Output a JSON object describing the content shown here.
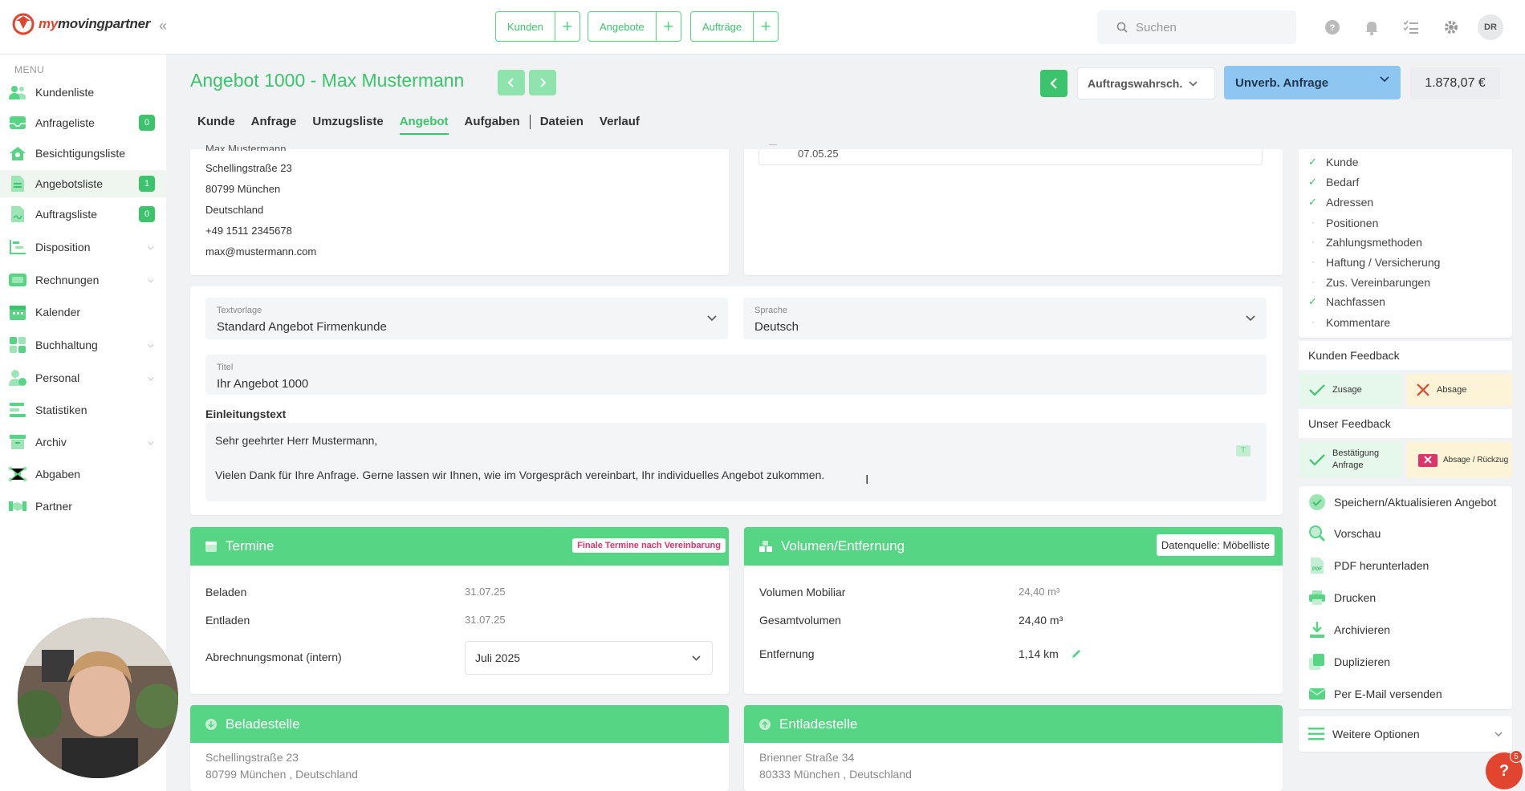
{
  "brand": {
    "logo_prefix": "my",
    "logo_main": "movingpartner"
  },
  "topbar": {
    "quick_buttons": [
      {
        "label": "Kunden"
      },
      {
        "label": "Angebote"
      },
      {
        "label": "Aufträge"
      }
    ],
    "search_placeholder": "Suchen",
    "avatar_initials": "DR",
    "help_badge": "5"
  },
  "sidebar": {
    "menu_label": "MENU",
    "items": [
      {
        "label": "Kundenliste"
      },
      {
        "label": "Anfrageliste",
        "badge": "0"
      },
      {
        "label": "Besichtigungsliste"
      },
      {
        "label": "Angebotsliste",
        "badge": "1",
        "active": true
      },
      {
        "label": "Auftragsliste",
        "badge": "0"
      },
      {
        "label": "Disposition"
      },
      {
        "label": "Rechnungen"
      },
      {
        "label": "Kalender"
      },
      {
        "label": "Buchhaltung"
      },
      {
        "label": "Personal"
      },
      {
        "label": "Statistiken"
      },
      {
        "label": "Archiv"
      },
      {
        "label": "Abgaben"
      },
      {
        "label": "Partner"
      }
    ]
  },
  "header": {
    "title": "Angebot 1000 - Max Mustermann",
    "tabs": [
      "Kunde",
      "Anfrage",
      "Umzugsliste",
      "Angebot",
      "Aufgaben",
      "Dateien",
      "Verlauf"
    ],
    "active_tab": "Angebot",
    "probability_select": "Auftragswahrsch.",
    "status_select": "Unverb. Anfrage",
    "total_price": "1.878,07 €"
  },
  "customer": {
    "name_cut": "Max Mustermann",
    "street": "Schellingstraße 23",
    "city": "80799 München",
    "country": "Deutschland",
    "phone": "+49 1511 2345678",
    "email": "max@mustermann.com",
    "date_value": "07.05.25"
  },
  "offer_form": {
    "template_label": "Textvorlage",
    "template_value": "Standard Angebot Firmenkunde",
    "language_label": "Sprache",
    "language_value": "Deutsch",
    "title_label": "Titel",
    "title_value": "Ihr Angebot 1000",
    "intro_label": "Einleitungstext",
    "intro_line1": "Sehr geehrter Herr Mustermann,",
    "intro_line2": "Vielen Dank für Ihre Anfrage. Gerne lassen wir Ihnen, wie im Vorgespräch vereinbart, Ihr individuelles Angebot zukommen."
  },
  "termine": {
    "title": "Termine",
    "badge": "Finale Termine nach Vereinbarung",
    "beladen_label": "Beladen",
    "beladen_value": "31.07.25",
    "entladen_label": "Entladen",
    "entladen_value": "31.07.25",
    "month_label": "Abrechnungsmonat (intern)",
    "month_value": "Juli 2025"
  },
  "volume": {
    "title": "Volumen/Entfernung",
    "source": "Datenquelle: Möbelliste",
    "mobiliar_label": "Volumen Mobiliar",
    "mobiliar_value": "24,40 m³",
    "total_label": "Gesamtvolumen",
    "total_value": "24,40 m³",
    "distance_label": "Entfernung",
    "distance_value": "1,14 km"
  },
  "beladestelle": {
    "title": "Beladestelle",
    "street": "Schellingstraße 23",
    "city": "80799 München , Deutschland"
  },
  "entladestelle": {
    "title": "Entladestelle",
    "street": "Brienner Straße 34",
    "city": "80333 München , Deutschland"
  },
  "checklist": [
    {
      "label": "Kunde",
      "done": true
    },
    {
      "label": "Bedarf",
      "done": true
    },
    {
      "label": "Adressen",
      "done": true
    },
    {
      "label": "Positionen",
      "done": false
    },
    {
      "label": "Zahlungsmethoden",
      "done": false
    },
    {
      "label": "Haftung / Versicherung",
      "done": false
    },
    {
      "label": "Zus. Vereinbarungen",
      "done": false
    },
    {
      "label": "Nachfassen",
      "done": true
    },
    {
      "label": "Kommentare",
      "done": false
    }
  ],
  "feedback": {
    "customer_title": "Kunden Feedback",
    "customer_yes": "Zusage",
    "customer_no": "Absage",
    "our_title": "Unser Feedback",
    "our_yes_line1": "Bestätigung",
    "our_yes_line2": "Anfrage",
    "our_no": "Absage / Rückzug"
  },
  "actions": [
    {
      "label": "Speichern/Aktualisieren Angebot",
      "icon": "check-circle-icon"
    },
    {
      "label": "Vorschau",
      "icon": "magnifier-icon"
    },
    {
      "label": "PDF herunterladen",
      "icon": "pdf-icon"
    },
    {
      "label": "Drucken",
      "icon": "printer-icon"
    },
    {
      "label": "Archivieren",
      "icon": "download-icon"
    },
    {
      "label": "Duplizieren",
      "icon": "duplicate-icon"
    },
    {
      "label": "Per E-Mail versenden",
      "icon": "envelope-icon"
    }
  ],
  "more_options": "Weitere Optionen",
  "colors": {
    "brand_green": "#3cc46c",
    "header_green": "#56d684",
    "status_blue": "#8ec6f2",
    "danger_red": "#e2452f"
  }
}
